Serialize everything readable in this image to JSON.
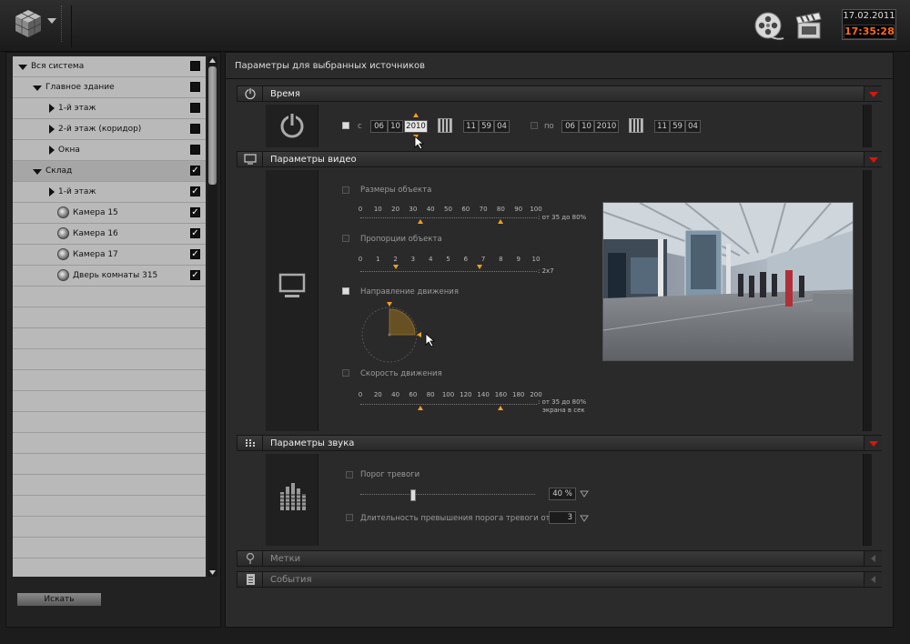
{
  "topbar": {
    "logo_icon": "cube-logo-icon",
    "menu_icon": "chevron-down-icon",
    "archive_icon": "film-reel-icon",
    "video_icon": "film-clapper-icon",
    "date": "17.02.2011",
    "time": "17:35:28",
    "time_color": "#ff6a1a"
  },
  "tree": {
    "rows": [
      {
        "label": "Вся система",
        "checked": false
      },
      {
        "label": "Главное здание",
        "checked": false
      },
      {
        "label": "1-й этаж",
        "checked": false
      },
      {
        "label": "2-й этаж (коридор)",
        "checked": false
      },
      {
        "label": "Окна",
        "checked": false
      },
      {
        "label": "Склад",
        "checked": true
      },
      {
        "label": "1-й этаж",
        "checked": true
      },
      {
        "label": "Камера 15",
        "checked": true
      },
      {
        "label": "Камера 16",
        "checked": true
      },
      {
        "label": "Камера 17",
        "checked": true
      },
      {
        "label": "Дверь комнаты 315",
        "checked": true
      }
    ],
    "search_button": "Искать"
  },
  "panel": {
    "title": "Параметры для выбранных источников",
    "time_section": {
      "title": "Время",
      "from_label": "с",
      "from_day": "06",
      "from_month": "10",
      "from_year": "2010",
      "from_hour": "11",
      "from_min": "59",
      "from_sec": "04",
      "to_label": "по",
      "to_day": "06",
      "to_month": "10",
      "to_year": "2010",
      "to_hour": "11",
      "to_min": "59",
      "to_sec": "04"
    },
    "video_section": {
      "title": "Параметры видео",
      "size_label": "Размеры объекта",
      "size_ticks": [
        "0",
        "10",
        "20",
        "30",
        "40",
        "50",
        "60",
        "70",
        "80",
        "90",
        "100"
      ],
      "size_range": ": от 35 до 80%",
      "size_min": 35,
      "size_max": 80,
      "ratio_label": "Пропорции объекта",
      "ratio_ticks": [
        "0",
        "1",
        "2",
        "3",
        "4",
        "5",
        "6",
        "7",
        "8",
        "9",
        "10"
      ],
      "ratio_range": ": 2х7",
      "ratio_min": 2,
      "ratio_max": 7,
      "direction_label": "Направление движения",
      "speed_label": "Скорость движения",
      "speed_ticks": [
        "0",
        "20",
        "40",
        "60",
        "80",
        "100",
        "120",
        "140",
        "160",
        "180",
        "200"
      ],
      "speed_range_1": ": от 35 до 80%",
      "speed_range_2": "экрана в сек",
      "speed_min": 35,
      "speed_max": 80
    },
    "sound_section": {
      "title": "Параметры звука",
      "threshold_label": "Порог тревоги",
      "threshold_value": "40 %",
      "duration_label": "Длительность превышения порога тревоги от",
      "duration_value": "3"
    },
    "tags_section": {
      "title": "Метки"
    },
    "events_section": {
      "title": "События"
    }
  }
}
